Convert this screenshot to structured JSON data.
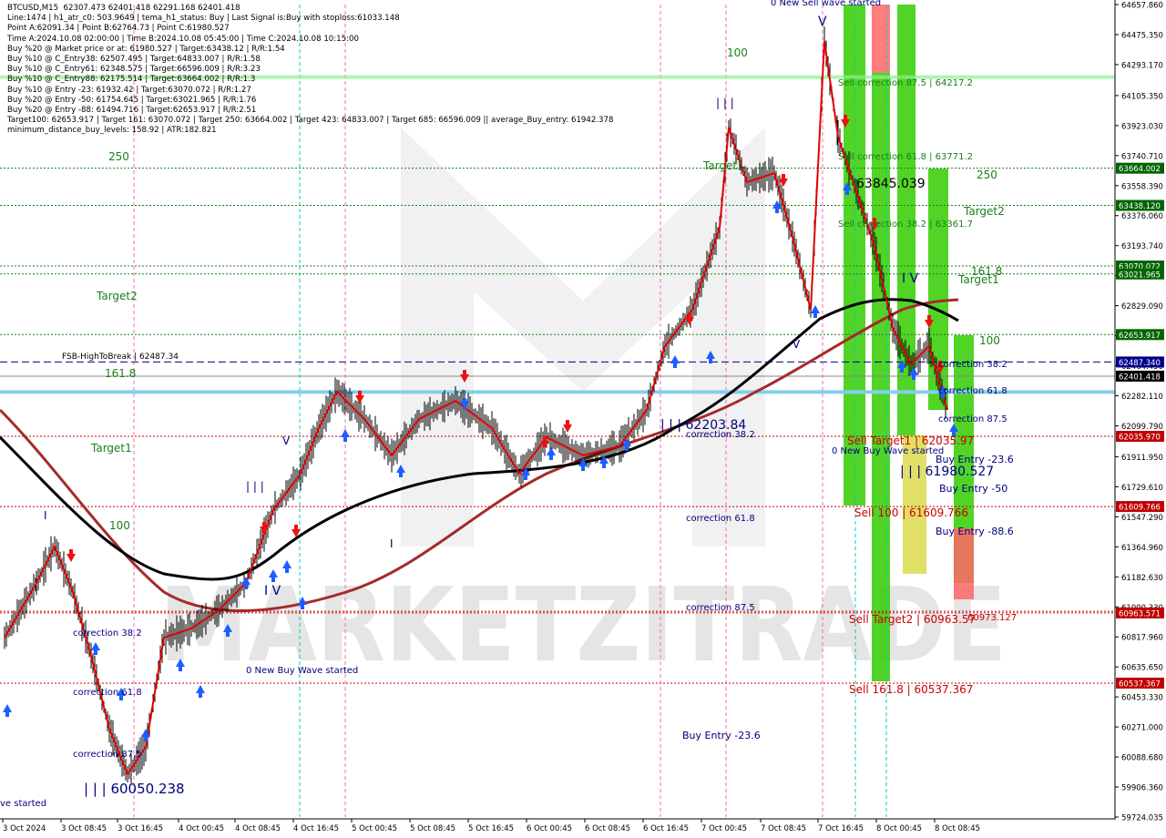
{
  "header": {
    "lines": [
      "BTCUSD,M15  62307.473 62401.418 62291.168 62401.418",
      "Line:1474 | h1_atr_c0: 503.9649 | tema_h1_status: Buy | Last Signal is:Buy with stoploss:61033.148",
      "Point A:62091.34 | Point B:62764.73 | Point C:61980.527",
      "Time A:2024.10.08 02:00:00 | Time B:2024.10.08 05:45:00 | Time C:2024.10.08 10:15:00",
      "Buy %20 @ Market price or at: 61980.527 | Target:63438.12 | R/R:1.54",
      "Buy %10 @ C_Entry38: 62507.495 | Target:64833.007 | R/R:1.58",
      "Buy %10 @ C_Entry61: 62348.575 | Target:66596.009 | R/R:3.23",
      "Buy %10 @ C_Entry88: 62175.514 | Target:63664.002 | R/R:1.3",
      "Buy %10 @ Entry -23: 61932.42 | Target:63070.072 | R/R:1.27",
      "Buy %20 @ Entry -50: 61754.645 | Target:63021.965 | R/R:1.76",
      "Buy %20 @ Entry -88: 61494.716 | Target:62653.917 | R/R:2.51",
      "Target100: 62653.917 | Target 161: 63070.072 | Target 250: 63664.002 | Target 423: 64833.007 | Target 685: 66596.009 || average_Buy_entry: 61942.378",
      "minimum_distance_buy_levels: 158.92 | ATR:182.821"
    ]
  },
  "colors": {
    "background": "#ffffff",
    "grid_text": "#000000",
    "red_line": "#e00000",
    "black_ma": "#000000",
    "brown_ma": "#a52a2a",
    "green_level": "#1a7f1a",
    "red_level": "#cc0000",
    "blue_level": "#00007f",
    "light_blue_level": "#87ceeb",
    "green_bar": "#33cc00",
    "red_bar": "#ff6666",
    "yellow_bar": "#cccc00",
    "label_box_green": "#006400",
    "label_box_red": "#c00000",
    "label_box_blue": "#00008b",
    "label_box_black": "#000000",
    "watermark": "#cfcfcf"
  },
  "watermark": "MARKETZITRADE",
  "chart_data": {
    "type": "line",
    "symbol": "BTCUSD",
    "timeframe": "M15",
    "ylim": [
      59724.035,
      64657.86
    ],
    "y_ticks": [
      "64657.860",
      "64475.350",
      "64293.170",
      "64105.350",
      "63923.030",
      "63740.710",
      "63558.390",
      "63376.060",
      "63193.740",
      "63011.420",
      "62829.090",
      "62646.770",
      "62464.450",
      "62282.110",
      "62099.790",
      "61911.950",
      "61729.610",
      "61547.290",
      "61364.960",
      "61182.630",
      "61000.330",
      "60817.960",
      "60635.650",
      "60453.330",
      "60271.000",
      "60088.680",
      "59906.360",
      "59724.035"
    ],
    "x_ticks": [
      "3 Oct 2024",
      "3 Oct 08:45",
      "3 Oct 16:45",
      "4 Oct 00:45",
      "4 Oct 08:45",
      "4 Oct 16:45",
      "5 Oct 00:45",
      "5 Oct 08:45",
      "5 Oct 16:45",
      "6 Oct 00:45",
      "6 Oct 08:45",
      "6 Oct 16:45",
      "7 Oct 00:45",
      "7 Oct 08:45",
      "7 Oct 16:45",
      "8 Oct 00:45",
      "8 Oct 08:45"
    ],
    "price_boxes": [
      {
        "label": "63664.002",
        "value": 63664.002,
        "color": "green"
      },
      {
        "label": "63438.120",
        "value": 63438.12,
        "color": "green"
      },
      {
        "label": "63070.072",
        "value": 63070.072,
        "color": "green"
      },
      {
        "label": "63021.965",
        "value": 63021.965,
        "color": "green"
      },
      {
        "label": "62653.917",
        "value": 62653.917,
        "color": "green"
      },
      {
        "label": "62487.340",
        "value": 62487.34,
        "color": "blue"
      },
      {
        "label": "62401.418",
        "value": 62401.418,
        "color": "black"
      },
      {
        "label": "62035.970",
        "value": 62035.97,
        "color": "red"
      },
      {
        "label": "61609.766",
        "value": 61609.766,
        "color": "red"
      },
      {
        "label": "60963.571",
        "value": 60963.571,
        "color": "red"
      },
      {
        "label": "60537.367",
        "value": 60537.367,
        "color": "red"
      }
    ],
    "horizontal_levels": [
      {
        "value": 64217.2,
        "color": "lightgreen",
        "style": "solid",
        "width": 4
      },
      {
        "value": 63664.002,
        "color": "green",
        "style": "dotted"
      },
      {
        "value": 63438.12,
        "color": "green",
        "style": "dotted"
      },
      {
        "value": 63070.072,
        "color": "green",
        "style": "dotted"
      },
      {
        "value": 63021.965,
        "color": "green",
        "style": "dotted"
      },
      {
        "value": 62653.917,
        "color": "green",
        "style": "dotted"
      },
      {
        "value": 62487.34,
        "color": "blue",
        "style": "dashed"
      },
      {
        "value": 62401.418,
        "color": "gray",
        "style": "solid"
      },
      {
        "value": 62305.0,
        "color": "lightblue",
        "style": "solid",
        "width": 4
      },
      {
        "value": 62035.97,
        "color": "red",
        "style": "dotted"
      },
      {
        "value": 61609.766,
        "color": "red",
        "style": "dotted"
      },
      {
        "value": 60973.127,
        "color": "red",
        "style": "dotted"
      },
      {
        "value": 60963.571,
        "color": "red",
        "style": "dotted"
      },
      {
        "value": 60537.367,
        "color": "red",
        "style": "dotted"
      }
    ],
    "annotations": [
      {
        "text": "100",
        "color": "green"
      },
      {
        "text": "250",
        "color": "green"
      },
      {
        "text": "Target2",
        "color": "green"
      },
      {
        "text": "161.8",
        "color": "green"
      },
      {
        "text": "Target1",
        "color": "green"
      },
      {
        "text": "100",
        "color": "green"
      },
      {
        "text": "Target2",
        "color": "green"
      },
      {
        "text": "161.8",
        "color": "green"
      },
      {
        "text": "Target1",
        "color": "green"
      },
      {
        "text": "100",
        "color": "green"
      },
      {
        "text": "250",
        "color": "green"
      },
      {
        "text": "Target1",
        "color": "green"
      },
      {
        "text": "FSB-HighToBreak | 62487.34",
        "color": "black"
      },
      {
        "text": "Sell correction 87.5 | 64217.2",
        "color": "green"
      },
      {
        "text": "Sell correction 61.8 | 63771.2",
        "color": "green"
      },
      {
        "text": "63845.039",
        "color": "black"
      },
      {
        "text": "Sell correction 38.2 | 63361.7",
        "color": "green"
      },
      {
        "text": "correction 38.2",
        "color": "blue"
      },
      {
        "text": "correction 61.8",
        "color": "blue"
      },
      {
        "text": "correction 87.5",
        "color": "blue"
      },
      {
        "text": "Sell Target1 | 62035.97",
        "color": "red"
      },
      {
        "text": "0 New Buy Wave started",
        "color": "blue"
      },
      {
        "text": "Buy Entry -23.6",
        "color": "blue"
      },
      {
        "text": "| | | 61980.527",
        "color": "blue"
      },
      {
        "text": "Buy Entry -50",
        "color": "blue"
      },
      {
        "text": "Sell 100 | 61609.766",
        "color": "red"
      },
      {
        "text": "Buy Entry -88.6",
        "color": "blue"
      },
      {
        "text": "Sell Target2 | 60963.57",
        "color": "red"
      },
      {
        "text": "60973.127",
        "color": "red"
      },
      {
        "text": "Sell 161.8 | 60537.367",
        "color": "red"
      },
      {
        "text": "| | | 62203.84",
        "color": "blue"
      },
      {
        "text": "correction 38.2",
        "color": "blue"
      },
      {
        "text": "correction 61.8",
        "color": "blue"
      },
      {
        "text": "correction 87.5",
        "color": "blue"
      },
      {
        "text": "Buy Entry -23.6",
        "color": "blue"
      },
      {
        "text": "0 New Buy Wave started",
        "color": "blue"
      },
      {
        "text": "correction 38.2",
        "color": "blue"
      },
      {
        "text": "correction 61.8",
        "color": "blue"
      },
      {
        "text": "correction 87.5",
        "color": "blue"
      },
      {
        "text": "| | | 60050.238",
        "color": "blue"
      },
      {
        "text": "ve started",
        "color": "blue"
      },
      {
        "text": "0 New Sell wave started",
        "color": "blue"
      },
      {
        "text": "| | |",
        "color": "blue"
      },
      {
        "text": "| | |",
        "color": "blue"
      },
      {
        "text": "I V",
        "color": "blue"
      },
      {
        "text": "I V",
        "color": "blue"
      },
      {
        "text": "V",
        "color": "blue"
      },
      {
        "text": "V",
        "color": "blue"
      },
      {
        "text": "V",
        "color": "blue"
      },
      {
        "text": "I",
        "color": "blue"
      },
      {
        "text": "I",
        "color": "black"
      }
    ]
  }
}
